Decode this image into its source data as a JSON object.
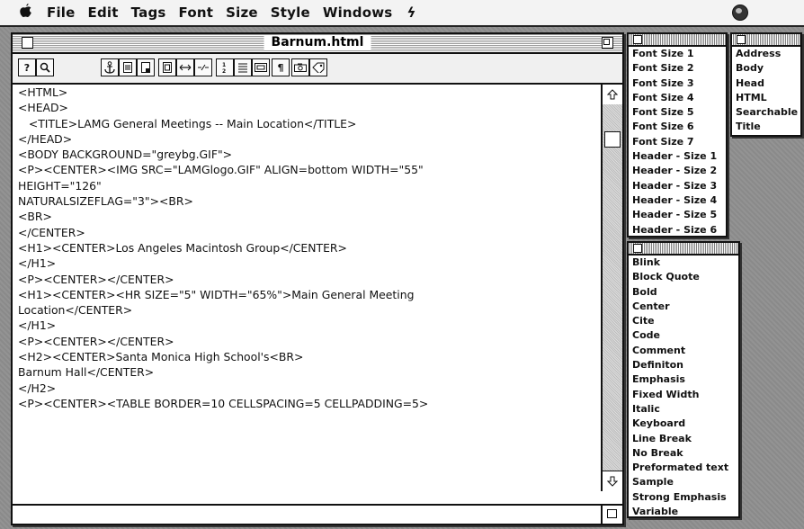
{
  "menubar": {
    "apple": "",
    "items": [
      "File",
      "Edit",
      "Tags",
      "Font",
      "Size",
      "Style",
      "Windows",
      "ϟ"
    ]
  },
  "window": {
    "title": "Barnum.html",
    "toolbar": [
      "?",
      "🔍",
      "⚓",
      "▤",
      "▯",
      "⎕",
      "⟷",
      "⇢",
      "⋮",
      "☰",
      "▭",
      "¶",
      "⊡",
      "⚑"
    ],
    "lines": [
      "<HTML>",
      "<HEAD>",
      "   <TITLE>LAMG General Meetings -- Main Location</TITLE>",
      "</HEAD>",
      "<BODY BACKGROUND=\"greybg.GIF\">",
      "<P><CENTER><IMG SRC=\"LAMGlogo.GIF\" ALIGN=bottom WIDTH=\"55\"",
      "HEIGHT=\"126\"",
      "NATURALSIZEFLAG=\"3\"><BR>",
      "<BR>",
      "</CENTER>",
      "<H1><CENTER>Los Angeles Macintosh Group</CENTER>",
      "</H1>",
      "<P><CENTER></CENTER>",
      "<H1><CENTER><HR SIZE=\"5\" WIDTH=\"65%\">Main General Meeting",
      "Location</CENTER>",
      "</H1>",
      "<P><CENTER></CENTER>",
      "<H2><CENTER>Santa Monica High School's<BR>",
      "Barnum Hall</CENTER>",
      "</H2>",
      "<P><CENTER><TABLE BORDER=10 CELLSPACING=5 CELLPADDING=5>"
    ]
  },
  "size_palette": {
    "items": [
      "Font Size 1",
      "Font Size 2",
      "Font Size 3",
      "Font Size 4",
      "Font Size 5",
      "Font Size 6",
      "Font Size 7",
      "Header - Size 1",
      "Header - Size 2",
      "Header - Size 3",
      "Header - Size 4",
      "Header - Size 5",
      "Header - Size 6"
    ]
  },
  "tags_palette": {
    "items": [
      "Address",
      "Body",
      "Head",
      "HTML",
      "Searchable",
      "Title"
    ]
  },
  "style_palette": {
    "items": [
      "Blink",
      "Block Quote",
      "Bold",
      "Center",
      "Cite",
      "Code",
      "Comment",
      "Definiton",
      "Emphasis",
      "Fixed Width",
      "Italic",
      "Keyboard",
      "Line Break",
      "No Break",
      "Preformated text",
      "Sample",
      "Strong Emphasis",
      "Variable"
    ]
  }
}
